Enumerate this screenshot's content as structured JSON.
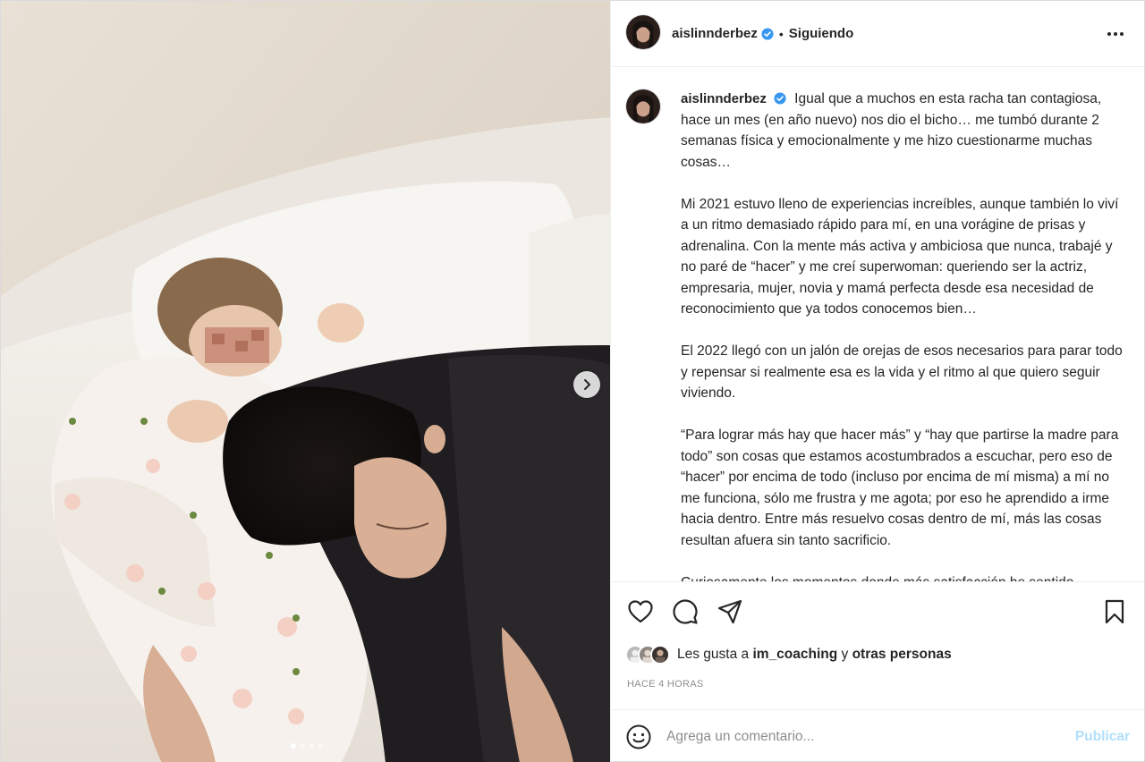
{
  "header": {
    "username": "aislinnderbez",
    "separator": "•",
    "follow_status": "Siguiendo"
  },
  "media": {
    "carousel_dots": 4,
    "active_dot": 1
  },
  "caption": {
    "username": "aislinnderbez",
    "paragraphs": [
      "Igual que a muchos en esta racha tan contagiosa, hace un mes (en año nuevo) nos dio el bicho… me tumbó durante 2 semanas física y emocionalmente y me hizo cuestionarme muchas cosas…",
      "Mi 2021 estuvo lleno de experiencias increíbles, aunque también lo viví a un ritmo demasiado rápido para mí, en una vorágine de prisas y adrenalina. Con la mente más activa y ambiciosa que nunca, trabajé y no paré de “hacer” y me creí superwoman: queriendo ser la actriz, empresaria, mujer, novia y mamá perfecta desde esa necesidad de reconocimiento que ya todos conocemos bien…",
      "El 2022 llegó con un jalón de orejas de esos necesarios para parar todo y repensar si realmente esa es la vida y el ritmo al que quiero seguir viviendo.",
      "“Para lograr más hay que hacer más” y “hay que partirse la madre para todo” son cosas que estamos acostumbrados a escuchar, pero eso de “hacer” por encima de todo (incluso por encima de mí misma) a mí no me funciona, sólo me frustra y me agota; por eso he aprendido a irme hacia dentro. Entre más resuelvo cosas dentro de mí, más las cosas resultan afuera sin tanto sacrificio.",
      "Curiosamente los momentos donde más satisfacción he sentido"
    ]
  },
  "likes": {
    "prefix": "Les gusta a",
    "user": "im_coaching",
    "connector": "y",
    "others": "otras personas"
  },
  "timestamp": "HACE 4 HORAS",
  "comment": {
    "placeholder": "Agrega un comentario...",
    "publish_label": "Publicar"
  },
  "colors": {
    "verified_blue": "#3897f0",
    "publish_disabled": "#b2dffc",
    "secondary_text": "#8e8e8e"
  },
  "icons": [
    "verified-badge-icon",
    "more-options-icon",
    "like-heart-icon",
    "comment-icon",
    "share-icon",
    "save-bookmark-icon",
    "emoji-icon",
    "next-arrow-icon"
  ]
}
